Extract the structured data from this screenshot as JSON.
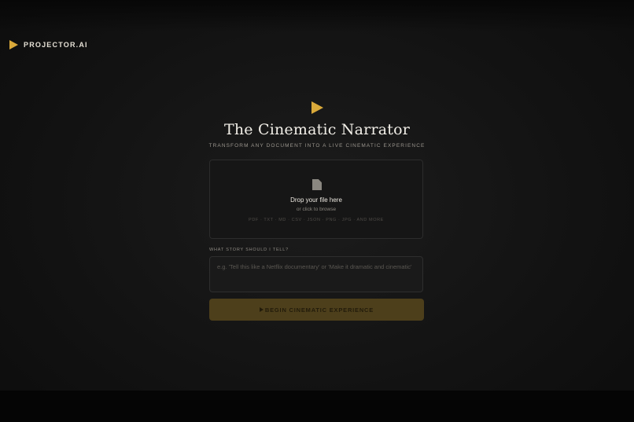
{
  "brand": {
    "name": "PROJECTOR.AI",
    "icon": "play-icon",
    "accent_color": "#d9a93a"
  },
  "hero": {
    "icon": "play-icon",
    "title": "The Cinematic Narrator",
    "subtitle": "TRANSFORM ANY DOCUMENT INTO A LIVE CINEMATIC EXPERIENCE"
  },
  "upload": {
    "icon": "file-icon",
    "title": "Drop your file here",
    "subtitle": "or click to browse",
    "formats": "PDF · TXT · MD · CSV · JSON · PNG · JPG · AND MORE"
  },
  "prompt": {
    "label": "WHAT STORY SHOULD I TELL?",
    "value": "",
    "placeholder": "e.g. 'Tell this like a Netflix documentary' or 'Make it dramatic and cinematic'"
  },
  "action": {
    "label": "BEGIN CINEMATIC EXPERIENCE",
    "icon": "play-icon",
    "state": "disabled",
    "color": "#4d3f1b"
  }
}
